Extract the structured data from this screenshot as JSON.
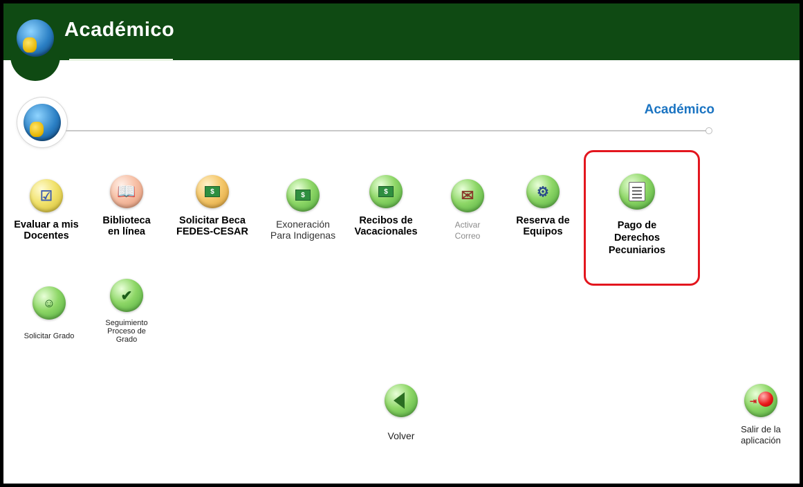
{
  "header": {
    "title": "Académico",
    "logo_icon": "book-globe-icon",
    "bar_color": "#0f4a13"
  },
  "section": {
    "title": "Académico",
    "logo_icon": "book-globe-icon",
    "title_color": "#1b74c2"
  },
  "apps": [
    {
      "id": "evaluar",
      "label_lines": [
        "Evaluar a mis",
        "Docentes"
      ],
      "icon": "checklist-icon"
    },
    {
      "id": "biblioteca",
      "label_lines": [
        "Biblioteca",
        "en línea"
      ],
      "icon": "open-book-icon"
    },
    {
      "id": "beca",
      "label_lines": [
        "Solicitar Beca",
        "FEDES-CESAR"
      ],
      "icon": "scholarship-money-icon"
    },
    {
      "id": "exoneracion",
      "label_lines": [
        "Exoneración",
        "Para Indigenas"
      ],
      "icon": "coins-money-icon"
    },
    {
      "id": "recibos",
      "label_lines": [
        "Recibos de",
        "Vacacionales"
      ],
      "icon": "receipt-money-icon"
    },
    {
      "id": "correo",
      "label_lines": [
        "Activar",
        "Correo"
      ],
      "icon": "mailbox-icon"
    },
    {
      "id": "reserva",
      "label_lines": [
        "Reserva de",
        "Equipos"
      ],
      "icon": "equipment-reservation-icon"
    },
    {
      "id": "pago",
      "label_lines": [
        "Pago de",
        "Derechos",
        "Pecuniarios"
      ],
      "icon": "payment-document-icon"
    },
    {
      "id": "grado",
      "label_lines": [
        "Solicitar Grado"
      ],
      "icon": "graduate-cursor-icon"
    },
    {
      "id": "seguimiento",
      "label_lines": [
        "Seguimiento",
        "Proceso de",
        "Grado"
      ],
      "icon": "graduate-check-icon"
    }
  ],
  "highlight_color": "#e3161e",
  "footer": {
    "back_label": "Volver",
    "back_icon": "back-arrow-icon",
    "exit_lines": [
      "Salir de la",
      "aplicación"
    ],
    "exit_icon": "exit-door-icon"
  }
}
